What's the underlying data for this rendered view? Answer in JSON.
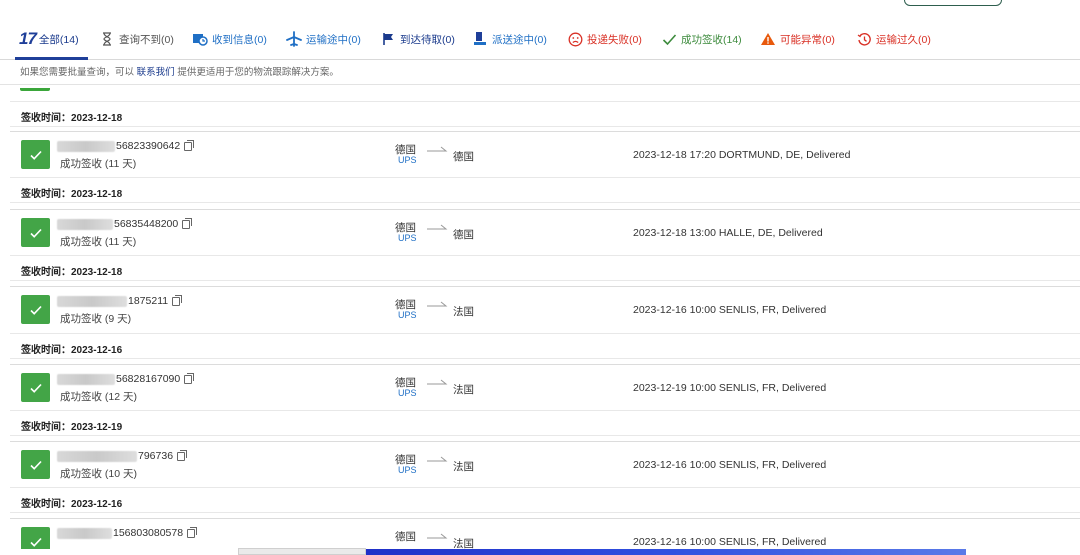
{
  "tabs": [
    {
      "id": "all",
      "label": "全部(14)",
      "logo": "17",
      "color": "#1a3a8c",
      "icon": "17track-logo"
    },
    {
      "id": "not-found",
      "label": "查询不到(0)",
      "color": "#555555",
      "icon": "hourglass-icon"
    },
    {
      "id": "info-received",
      "label": "收到信息(0)",
      "color": "#1f6fc5",
      "icon": "package-clock-icon"
    },
    {
      "id": "in-transit",
      "label": "运输途中(0)",
      "color": "#1f6fc5",
      "icon": "airplane-icon"
    },
    {
      "id": "pickup",
      "label": "到达待取(0)",
      "color": "#1a3a8c",
      "icon": "flag-icon"
    },
    {
      "id": "out-for-delivery",
      "label": "派送途中(0)",
      "color": "#1f6fc5",
      "icon": "courier-icon"
    },
    {
      "id": "failed",
      "label": "投递失败(0)",
      "color": "#d93025",
      "icon": "sad-face-icon"
    },
    {
      "id": "delivered",
      "label": "成功签收(14)",
      "color": "#3d8b3d",
      "icon": "checkmark-icon"
    },
    {
      "id": "exception",
      "label": "可能异常(0)",
      "color": "#d93025",
      "icon": "warning-icon"
    },
    {
      "id": "expired",
      "label": "运输过久(0)",
      "color": "#d93025",
      "icon": "clock-history-icon"
    }
  ],
  "notice": {
    "before": "如果您需要批量查询，可以",
    "link": "联系我们",
    "after": "提供更适用于您的物流跟踪解决方案。"
  },
  "sign_rows": [
    {
      "label": "签收时间：2023-12-18"
    },
    {
      "label": "签收时间：2023-12-18"
    },
    {
      "label": "签收时间：2023-12-18"
    },
    {
      "label": "签收时间：2023-12-16"
    },
    {
      "label": "签收时间：2023-12-19"
    },
    {
      "label": "签收时间：2023-12-16"
    }
  ],
  "shipments": [
    {
      "number_visible": "56823390642",
      "status": "成功签收 (11 天)",
      "origin": "德国",
      "carrier": "UPS",
      "destination": "德国",
      "event": "2023-12-18 17:20 DORTMUND, DE, Delivered"
    },
    {
      "number_visible": "56835448200",
      "status": "成功签收 (11 天)",
      "origin": "德国",
      "carrier": "UPS",
      "destination": "德国",
      "event": "2023-12-18 13:00 HALLE, DE, Delivered"
    },
    {
      "number_visible": "1875211",
      "status": "成功签收 (9 天)",
      "origin": "德国",
      "carrier": "UPS",
      "destination": "法国",
      "event": "2023-12-16 10:00 SENLIS, FR, Delivered"
    },
    {
      "number_visible": "56828167090",
      "status": "成功签收 (12 天)",
      "origin": "德国",
      "carrier": "UPS",
      "destination": "法国",
      "event": "2023-12-19 10:00 SENLIS, FR, Delivered"
    },
    {
      "number_visible": "796736",
      "status": "成功签收 (10 天)",
      "origin": "德国",
      "carrier": "UPS",
      "destination": "法国",
      "event": "2023-12-16 10:00 SENLIS, FR, Delivered"
    },
    {
      "number_visible": "156803080578",
      "status": "",
      "origin": "德国",
      "carrier": "",
      "destination": "法国",
      "event": "2023-12-16 10:00 SENLIS, FR, Delivered"
    }
  ],
  "colors": {
    "delivered_green": "#43a547",
    "brand_blue": "#1f3f99",
    "link_blue": "#1f6fc5"
  }
}
